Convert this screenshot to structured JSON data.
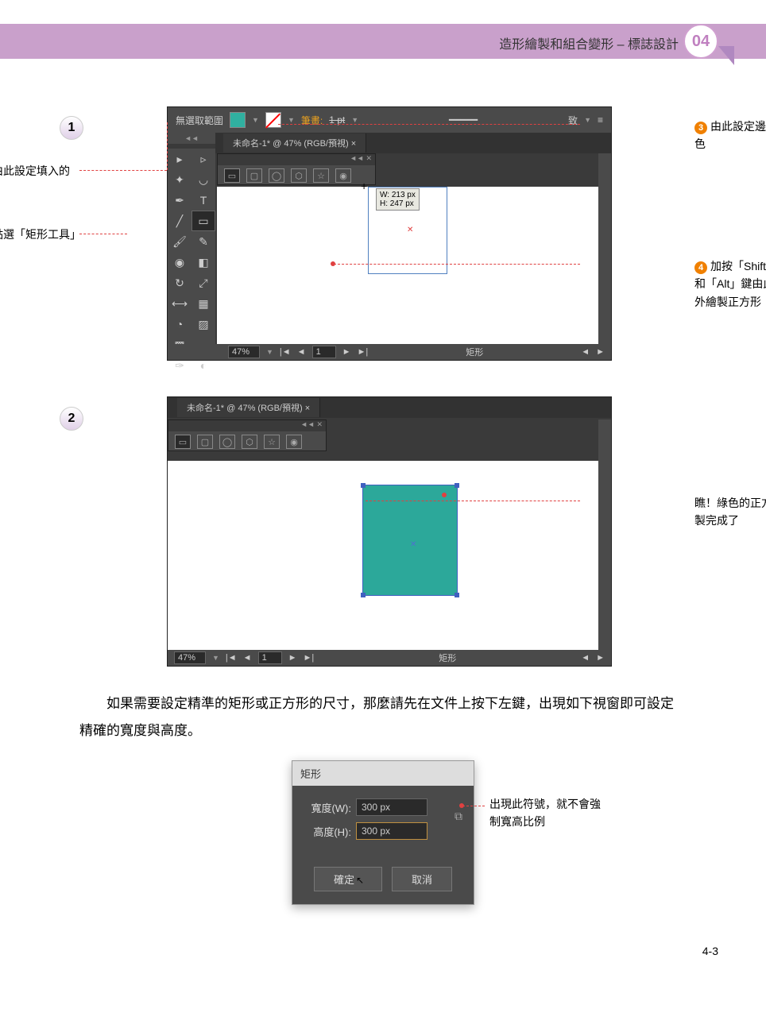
{
  "header": {
    "title": "造形繪製和組合變形 – 標誌設計",
    "chapter_num": "04"
  },
  "step1": {
    "num": "1"
  },
  "step2": {
    "num": "2"
  },
  "ctrlbar": {
    "no_selection": "無選取範圍",
    "stroke_label": "筆畫:",
    "stroke_val": "1 pt",
    "align_label": "致"
  },
  "tab": {
    "name": "未命名-1* @ 47% (RGB/預視)",
    "close": "×"
  },
  "panel_hdr": {
    "collapse": "◄◄",
    "close": "✕"
  },
  "drawing": {
    "w_label": "W: 213 px",
    "h_label": "H: 247 px"
  },
  "status": {
    "zoom": "47%",
    "page": "1",
    "shape": "矩形"
  },
  "callouts": {
    "c1": {
      "n": "1",
      "text": "點選「矩形工具」鈕"
    },
    "c2": {
      "n": "2",
      "text": "由此設定填入的色彩"
    },
    "c3": {
      "n": "3",
      "text": "由此設定邊框顏色"
    },
    "c4": {
      "n": "4",
      "text": "加按「Shift」鍵 和「Alt」鍵由此處往外繪製正方形"
    },
    "c5": {
      "text": "瞧！綠色的正方形繪製完成了"
    },
    "c6": {
      "text": "出現此符號，就不會強制寬高比例"
    }
  },
  "body_text": "如果需要設定精準的矩形或正方形的尺寸，那麼請先在文件上按下左鍵，出現如下視窗即可設定精確的寬度與高度。",
  "dialog": {
    "title": "矩形",
    "width_label": "寬度(W):",
    "width_val": "300 px",
    "height_label": "高度(H):",
    "height_val": "300 px",
    "link_icon": "⧉",
    "ok": "確定",
    "cancel": "取消"
  },
  "page_num": "4-3"
}
